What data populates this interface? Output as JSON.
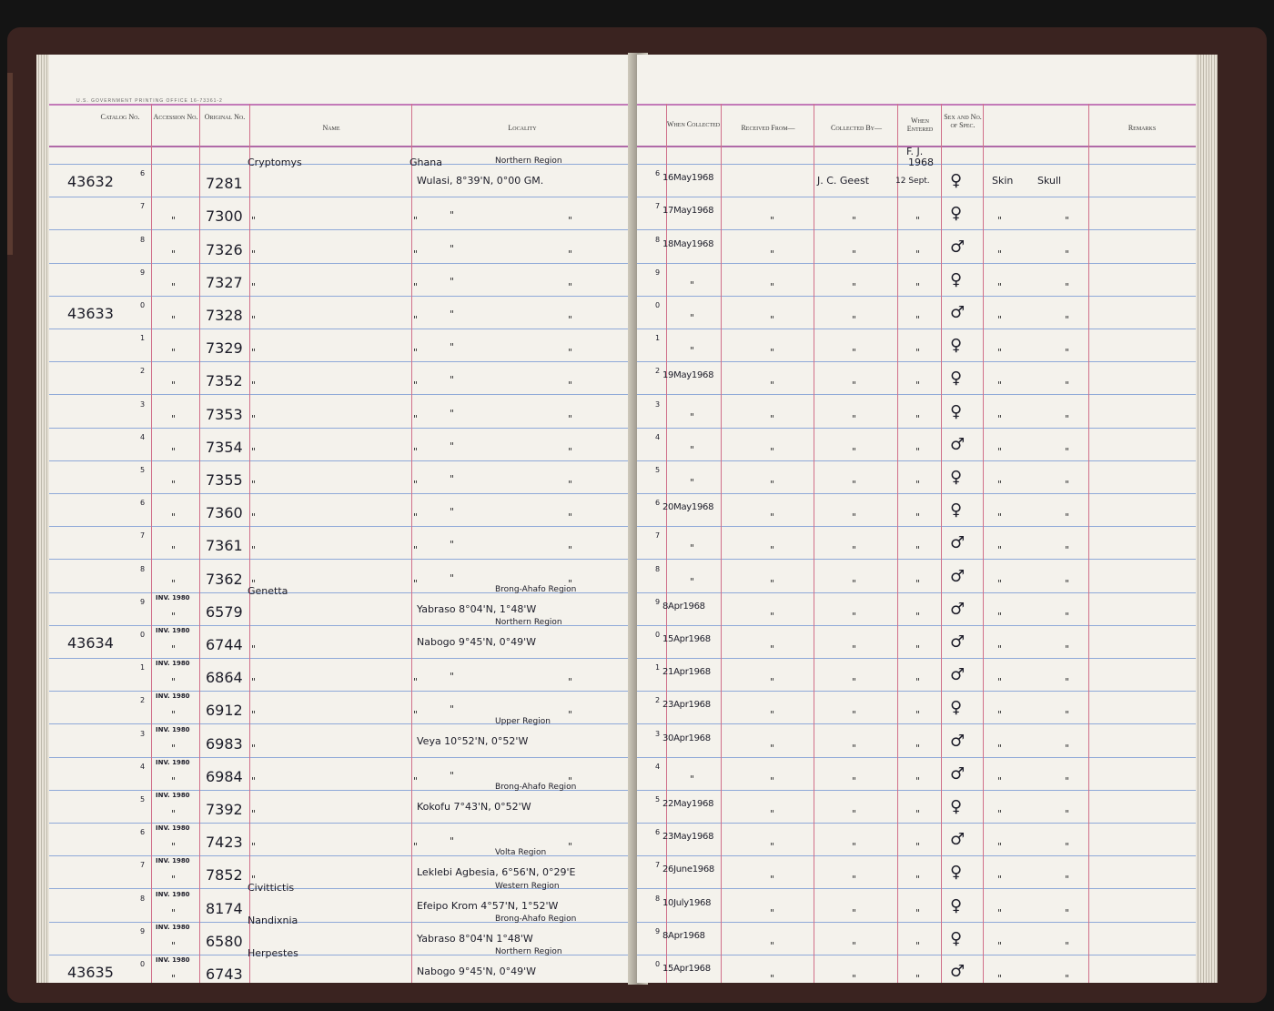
{
  "printer_line": "U.S. GOVERNMENT PRINTING OFFICE  16-73361-2",
  "headers": {
    "catalog": "Catalog No.",
    "accession": "Accession No.",
    "original": "Original No.",
    "name": "Name",
    "locality": "Locality",
    "when_collected": "When Collected",
    "received_from": "Received From—",
    "collected_by": "Collected By—",
    "when_entered": "When Entered",
    "sex": "Sex and No. of Spec.",
    "remarks": "Remarks"
  },
  "entered": {
    "initials": "F. J.",
    "year": "1968",
    "date": "12 Sept."
  },
  "collector": "J. C. Geest",
  "remarks_first": {
    "a": "Skin",
    "b": "Skull"
  },
  "ditto": "\"",
  "rows": [
    {
      "cat": "43632",
      "d": "6",
      "acc": "",
      "orig": "7281",
      "name": "Cryptomys",
      "region": "Ghana",
      "region2": "Northern Region",
      "loc": "Wulasi, 8°39'N, 0°00 GM.",
      "date": "16May1968",
      "sex": "♀"
    },
    {
      "cat": "",
      "d": "7",
      "acc": "",
      "orig": "7300",
      "name": "",
      "region": "",
      "region2": "",
      "loc": "",
      "date": "17May1968",
      "sex": "♀"
    },
    {
      "cat": "",
      "d": "8",
      "acc": "",
      "orig": "7326",
      "name": "",
      "region": "",
      "region2": "",
      "loc": "",
      "date": "18May1968",
      "sex": "♂"
    },
    {
      "cat": "",
      "d": "9",
      "acc": "",
      "orig": "7327",
      "name": "",
      "region": "",
      "region2": "",
      "loc": "",
      "date": "",
      "sex": "♀"
    },
    {
      "cat": "43633",
      "d": "0",
      "acc": "",
      "orig": "7328",
      "name": "",
      "region": "",
      "region2": "",
      "loc": "",
      "date": "",
      "sex": "♂"
    },
    {
      "cat": "",
      "d": "1",
      "acc": "",
      "orig": "7329",
      "name": "",
      "region": "",
      "region2": "",
      "loc": "",
      "date": "",
      "sex": "♀"
    },
    {
      "cat": "",
      "d": "2",
      "acc": "",
      "orig": "7352",
      "name": "",
      "region": "",
      "region2": "",
      "loc": "",
      "date": "19May1968",
      "sex": "♀"
    },
    {
      "cat": "",
      "d": "3",
      "acc": "",
      "orig": "7353",
      "name": "",
      "region": "",
      "region2": "",
      "loc": "",
      "date": "",
      "sex": "♀"
    },
    {
      "cat": "",
      "d": "4",
      "acc": "",
      "orig": "7354",
      "name": "",
      "region": "",
      "region2": "",
      "loc": "",
      "date": "",
      "sex": "♂"
    },
    {
      "cat": "",
      "d": "5",
      "acc": "",
      "orig": "7355",
      "name": "",
      "region": "",
      "region2": "",
      "loc": "",
      "date": "",
      "sex": "♀"
    },
    {
      "cat": "",
      "d": "6",
      "acc": "",
      "orig": "7360",
      "name": "",
      "region": "",
      "region2": "",
      "loc": "",
      "date": "20May1968",
      "sex": "♀"
    },
    {
      "cat": "",
      "d": "7",
      "acc": "",
      "orig": "7361",
      "name": "",
      "region": "",
      "region2": "",
      "loc": "",
      "date": "",
      "sex": "♂"
    },
    {
      "cat": "",
      "d": "8",
      "acc": "",
      "orig": "7362",
      "name": "",
      "region": "",
      "region2": "",
      "loc": "",
      "date": "",
      "sex": "♂"
    },
    {
      "cat": "",
      "d": "9",
      "acc": "INV. 1980",
      "orig": "6579",
      "name": "Genetta",
      "region": "",
      "region2": "Brong-Ahafo Region",
      "loc": "Yabraso 8°04'N, 1°48'W",
      "date": "8Apr1968",
      "sex": "♂"
    },
    {
      "cat": "43634",
      "d": "0",
      "acc": "INV. 1980",
      "orig": "6744",
      "name": "",
      "region": "",
      "region2": "Northern Region",
      "loc": "Nabogo   9°45'N, 0°49'W",
      "date": "15Apr1968",
      "sex": "♂"
    },
    {
      "cat": "",
      "d": "1",
      "acc": "INV. 1980",
      "orig": "6864",
      "name": "",
      "region": "",
      "region2": "",
      "loc": "",
      "date": "21Apr1968",
      "sex": "♂"
    },
    {
      "cat": "",
      "d": "2",
      "acc": "INV. 1980",
      "orig": "6912",
      "name": "",
      "region": "",
      "region2": "",
      "loc": "",
      "date": "23Apr1968",
      "sex": "♀"
    },
    {
      "cat": "",
      "d": "3",
      "acc": "INV. 1980",
      "orig": "6983",
      "name": "",
      "region": "",
      "region2": "Upper Region",
      "loc": "Veya      10°52'N, 0°52'W",
      "date": "30Apr1968",
      "sex": "♂"
    },
    {
      "cat": "",
      "d": "4",
      "acc": "INV. 1980",
      "orig": "6984",
      "name": "",
      "region": "",
      "region2": "",
      "loc": "",
      "date": "",
      "sex": "♂"
    },
    {
      "cat": "",
      "d": "5",
      "acc": "INV. 1980",
      "orig": "7392",
      "name": "",
      "region": "",
      "region2": "Brong-Ahafo Region",
      "loc": "Kokofu   7°43'N, 0°52'W",
      "date": "22May1968",
      "sex": "♀"
    },
    {
      "cat": "",
      "d": "6",
      "acc": "INV. 1980",
      "orig": "7423",
      "name": "",
      "region": "",
      "region2": "",
      "loc": "",
      "date": "23May1968",
      "sex": "♂"
    },
    {
      "cat": "",
      "d": "7",
      "acc": "INV. 1980",
      "orig": "7852",
      "name": "",
      "region": "",
      "region2": "Volta Region",
      "loc": "Leklebi Agbesia, 6°56'N, 0°29'E",
      "date": "26June1968",
      "sex": "♀"
    },
    {
      "cat": "",
      "d": "8",
      "acc": "INV. 1980",
      "orig": "8174",
      "name": "Civittictis",
      "region": "",
      "region2": "Western Region",
      "loc": "Efeipo Krom 4°57'N, 1°52'W",
      "date": "10July1968",
      "sex": "♀"
    },
    {
      "cat": "",
      "d": "9",
      "acc": "INV. 1980",
      "orig": "6580",
      "name": "Nandixnia",
      "region": "",
      "region2": "Brong-Ahafo Region",
      "loc": "Yabraso    8°04'N  1°48'W",
      "date": "8Apr1968",
      "sex": "♀"
    },
    {
      "cat": "43635",
      "d": "0",
      "acc": "INV. 1980",
      "orig": "6743",
      "name": "Herpestes",
      "region": "",
      "region2": "Northern Region",
      "loc": "Nabogo  9°45'N, 0°49'W",
      "date": "15Apr1968",
      "sex": "♂"
    }
  ]
}
